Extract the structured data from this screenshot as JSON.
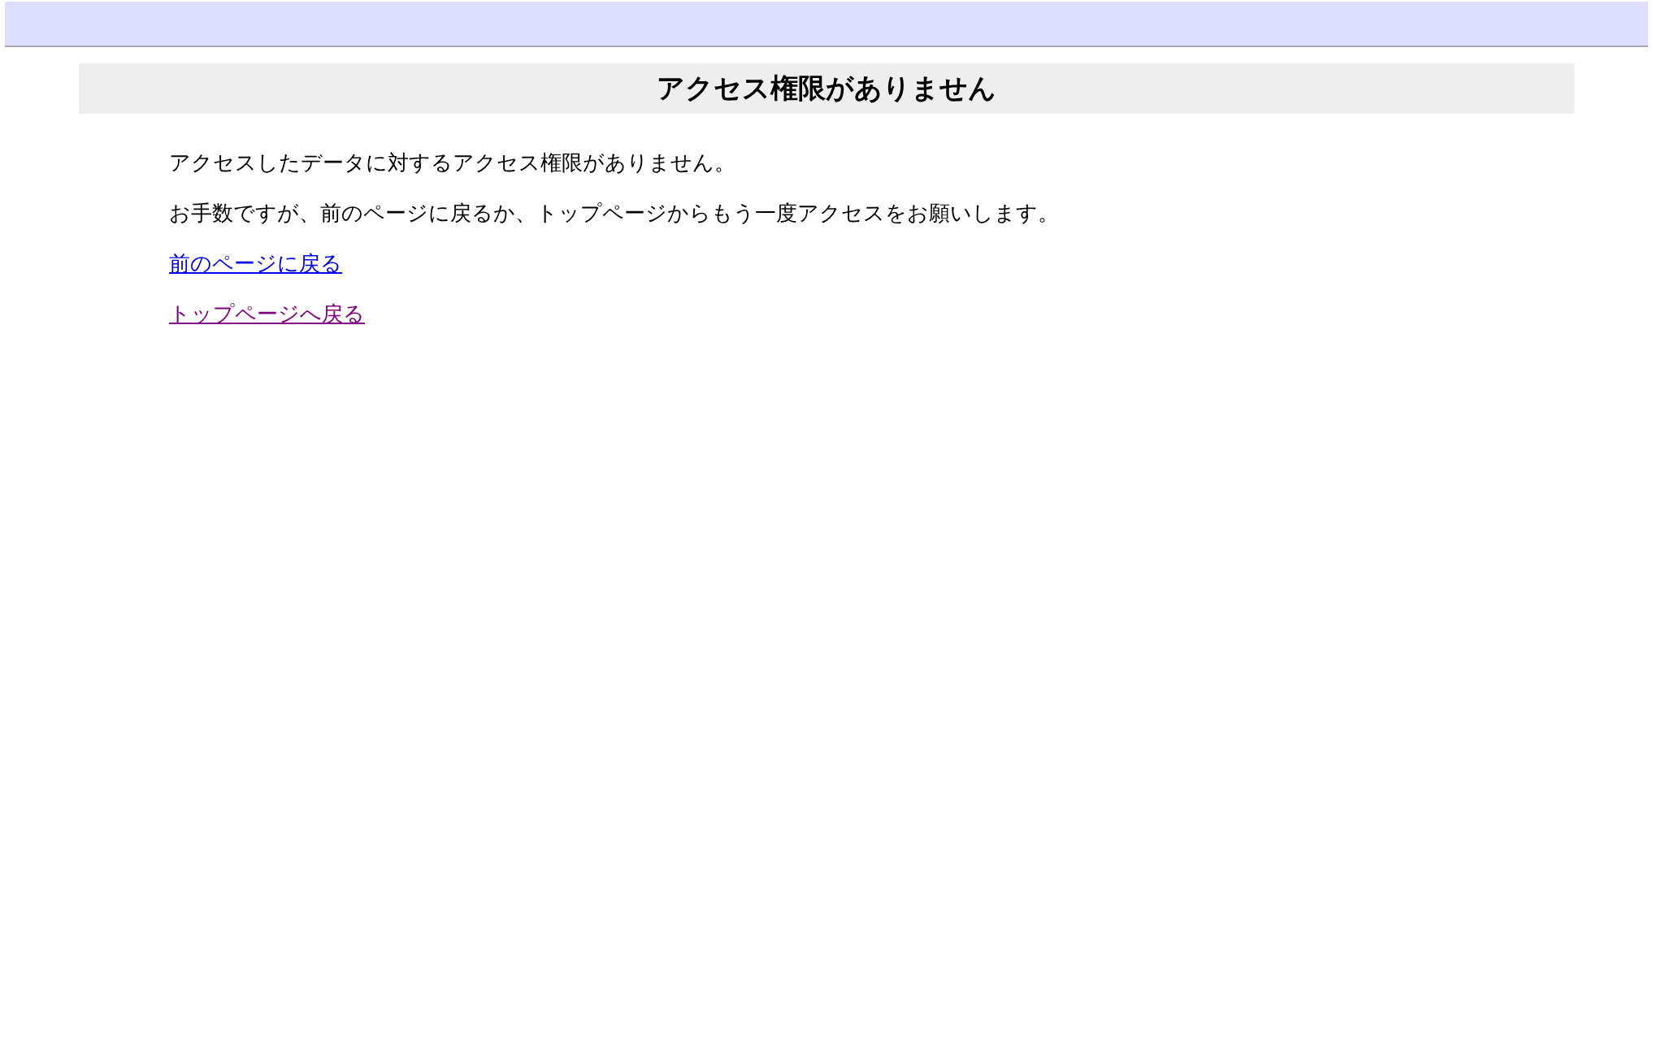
{
  "header": {
    "title": "アクセス権限がありません"
  },
  "paragraphs": [
    "アクセスしたデータに対するアクセス権限がありません。",
    "お手数ですが、前のページに戻るか、トップページからもう一度アクセスをお願いします。"
  ],
  "links": [
    {
      "label": "前のページに戻る",
      "visited": false
    },
    {
      "label": "トップページへ戻る",
      "visited": true
    }
  ]
}
